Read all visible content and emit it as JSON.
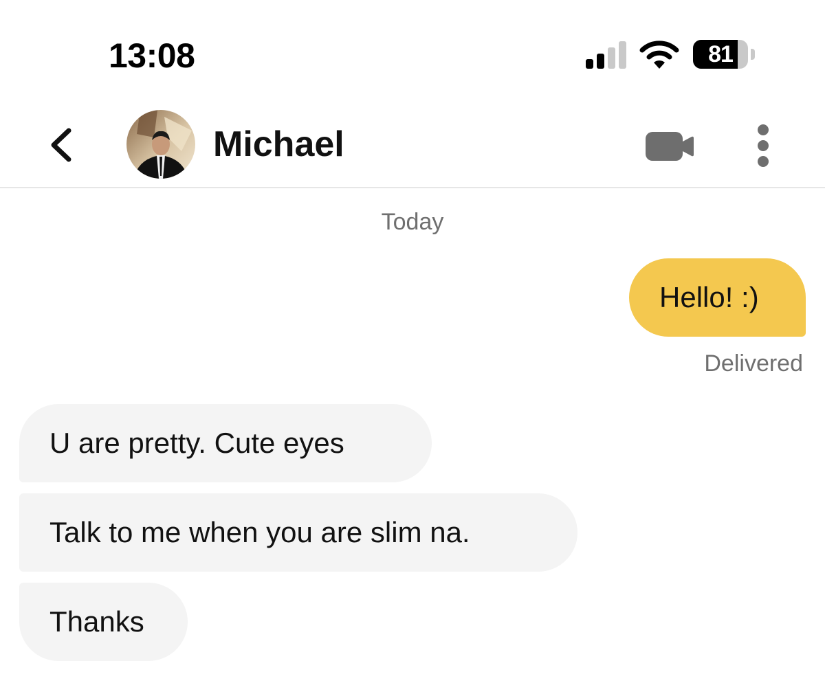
{
  "status_bar": {
    "time": "13:08",
    "battery_level": "81",
    "battery_fraction": 0.81,
    "icons": [
      "signal-icon",
      "wifi-icon",
      "battery-icon"
    ]
  },
  "header": {
    "contact_name": "Michael",
    "icons": [
      "back-chevron-icon",
      "avatar",
      "video-camera-icon",
      "more-vertical-icon"
    ]
  },
  "conversation": {
    "date_label": "Today",
    "messages": [
      {
        "direction": "outgoing",
        "text": "Hello! :)",
        "status": "Delivered"
      },
      {
        "direction": "incoming",
        "text": "U are pretty. Cute eyes"
      },
      {
        "direction": "incoming",
        "text": "Talk to me when you are slim na."
      },
      {
        "direction": "incoming",
        "text": "Thanks"
      }
    ]
  },
  "colors": {
    "outgoing_bubble": "#f4c84f",
    "incoming_bubble": "#f4f4f4",
    "meta_text": "#6f6f6f",
    "icon_gray": "#6e6e6e"
  }
}
